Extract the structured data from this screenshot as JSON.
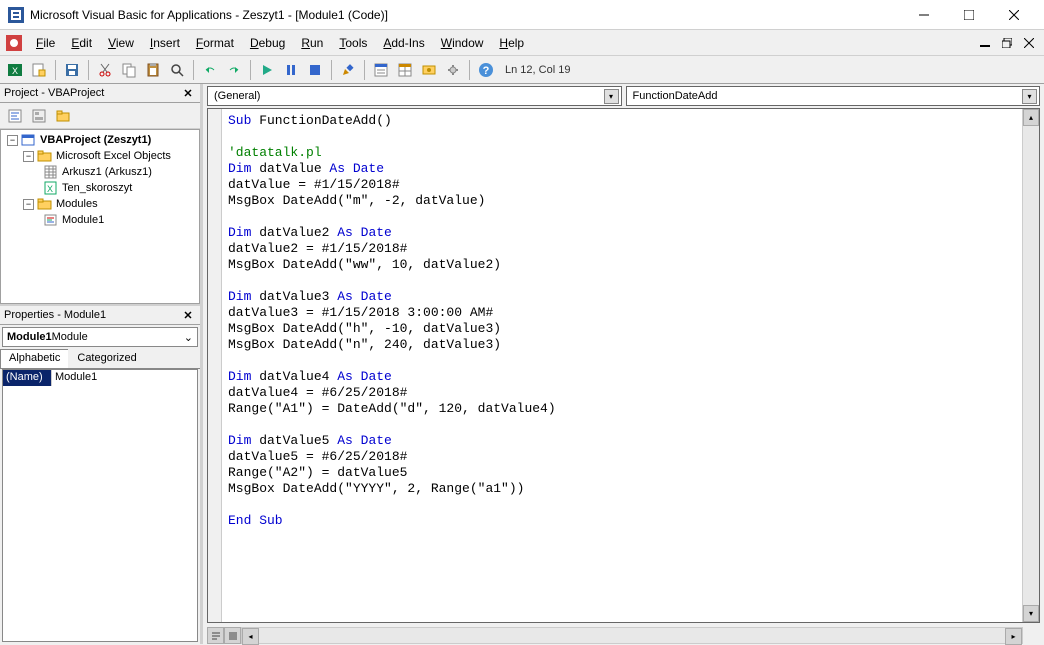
{
  "window": {
    "title": "Microsoft Visual Basic for Applications - Zeszyt1 - [Module1 (Code)]"
  },
  "menus": [
    "File",
    "Edit",
    "View",
    "Insert",
    "Format",
    "Debug",
    "Run",
    "Tools",
    "Add-Ins",
    "Window",
    "Help"
  ],
  "cursor_pos": "Ln 12, Col 19",
  "project_panel": {
    "title": "Project - VBAProject",
    "root": "VBAProject (Zeszyt1)",
    "excel_group": "Microsoft Excel Objects",
    "sheet1": "Arkusz1 (Arkusz1)",
    "workbook": "Ten_skoroszyt",
    "modules_group": "Modules",
    "module1": "Module1"
  },
  "properties_panel": {
    "title": "Properties - Module1",
    "object_name": "Module1",
    "object_type": " Module",
    "tab_alpha": "Alphabetic",
    "tab_cat": "Categorized",
    "prop_name_label": "(Name)",
    "prop_name_value": "Module1"
  },
  "code_dropdowns": {
    "left": "(General)",
    "right": "FunctionDateAdd"
  },
  "code_tokens": [
    [
      [
        "kw",
        "Sub"
      ],
      [
        "",
        " FunctionDateAdd()"
      ]
    ],
    [
      [
        "",
        ""
      ]
    ],
    [
      [
        "cm",
        "'datatalk.pl"
      ]
    ],
    [
      [
        "kw",
        "Dim"
      ],
      [
        "",
        " datValue "
      ],
      [
        "kw",
        "As Date"
      ]
    ],
    [
      [
        "",
        "datValue = #1/15/2018#"
      ]
    ],
    [
      [
        "",
        "MsgBox DateAdd(\"m\", -2, datValue)"
      ]
    ],
    [
      [
        "",
        ""
      ]
    ],
    [
      [
        "kw",
        "Dim"
      ],
      [
        "",
        " datValue2 "
      ],
      [
        "kw",
        "As Date"
      ]
    ],
    [
      [
        "",
        "datValue2 = #1/15/2018#"
      ]
    ],
    [
      [
        "",
        "MsgBox DateAdd(\"ww\", 10, datValue2)"
      ]
    ],
    [
      [
        "",
        ""
      ]
    ],
    [
      [
        "kw",
        "Dim"
      ],
      [
        "",
        " datValue3 "
      ],
      [
        "kw",
        "As Date"
      ]
    ],
    [
      [
        "",
        "datValue3 = #1/15/2018 3:00:00 AM#"
      ]
    ],
    [
      [
        "",
        "MsgBox DateAdd(\"h\", -10, datValue3)"
      ]
    ],
    [
      [
        "",
        "MsgBox DateAdd(\"n\", 240, datValue3)"
      ]
    ],
    [
      [
        "",
        ""
      ]
    ],
    [
      [
        "kw",
        "Dim"
      ],
      [
        "",
        " datValue4 "
      ],
      [
        "kw",
        "As Date"
      ]
    ],
    [
      [
        "",
        "datValue4 = #6/25/2018#"
      ]
    ],
    [
      [
        "",
        "Range(\"A1\") = DateAdd(\"d\", 120, datValue4)"
      ]
    ],
    [
      [
        "",
        ""
      ]
    ],
    [
      [
        "kw",
        "Dim"
      ],
      [
        "",
        " datValue5 "
      ],
      [
        "kw",
        "As Date"
      ]
    ],
    [
      [
        "",
        "datValue5 = #6/25/2018#"
      ]
    ],
    [
      [
        "",
        "Range(\"A2\") = datValue5"
      ]
    ],
    [
      [
        "",
        "MsgBox DateAdd(\"YYYY\", 2, Range(\"a1\"))"
      ]
    ],
    [
      [
        "",
        ""
      ]
    ],
    [
      [
        "kw",
        "End Sub"
      ]
    ]
  ]
}
